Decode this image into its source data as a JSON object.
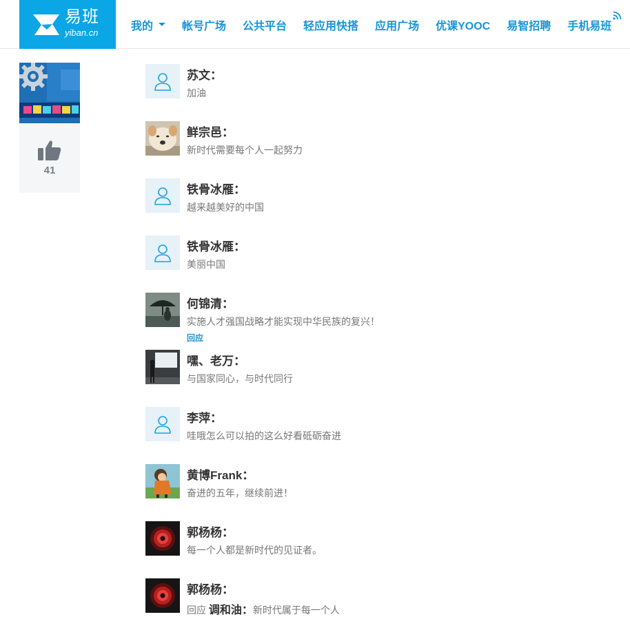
{
  "brand": {
    "name": "易班",
    "domain": "yiban.cn",
    "color": "#0ba6e6"
  },
  "nav": [
    {
      "label": "我的",
      "has_dropdown": true
    },
    {
      "label": "帐号广场"
    },
    {
      "label": "公共平台"
    },
    {
      "label": "轻应用快搭"
    },
    {
      "label": "应用广场"
    },
    {
      "label": "优课YOOC"
    },
    {
      "label": "易智招聘"
    },
    {
      "label": "手机易班"
    }
  ],
  "post": {
    "like_count": "41",
    "thumbnail_icon": "gear-banner-image"
  },
  "reply_label": "回应",
  "comments": [
    {
      "name": "苏文：",
      "text": "加油",
      "avatar": "default-avatar-icon"
    },
    {
      "name": "鲜宗邑：",
      "text": "新时代需要每个人一起努力",
      "avatar": "dog-photo"
    },
    {
      "name": "铁骨冰雁：",
      "text": "越来越美好的中国",
      "avatar": "default-avatar-icon"
    },
    {
      "name": "铁骨冰雁：",
      "text": "美丽中国",
      "avatar": "default-avatar-icon"
    },
    {
      "name": "何锦清：",
      "text": "实施人才强国战略才能实现中华民族的复兴！",
      "avatar": "umbrella-photo",
      "reply_link": "回应"
    },
    {
      "name": "嘿、老万：",
      "text": "与国家同心，与时代同行",
      "avatar": "speaker-photo"
    },
    {
      "name": "李萍：",
      "text": "哇哦怎么可以拍的这么好看砥砺奋进",
      "avatar": "default-avatar-icon"
    },
    {
      "name": "黄博Frank：",
      "text": "奋进的五年，继续前进！",
      "avatar": "cartoon-girl-photo"
    },
    {
      "name": "郭杨杨：",
      "text": "每一个人都是新时代的见证者。",
      "avatar": "red-eye-photo"
    },
    {
      "name": "郭杨杨：",
      "reply_prefix": "回应",
      "reply_target": "调和油：",
      "text": "新时代属于每一个人",
      "avatar": "red-eye-photo"
    }
  ]
}
